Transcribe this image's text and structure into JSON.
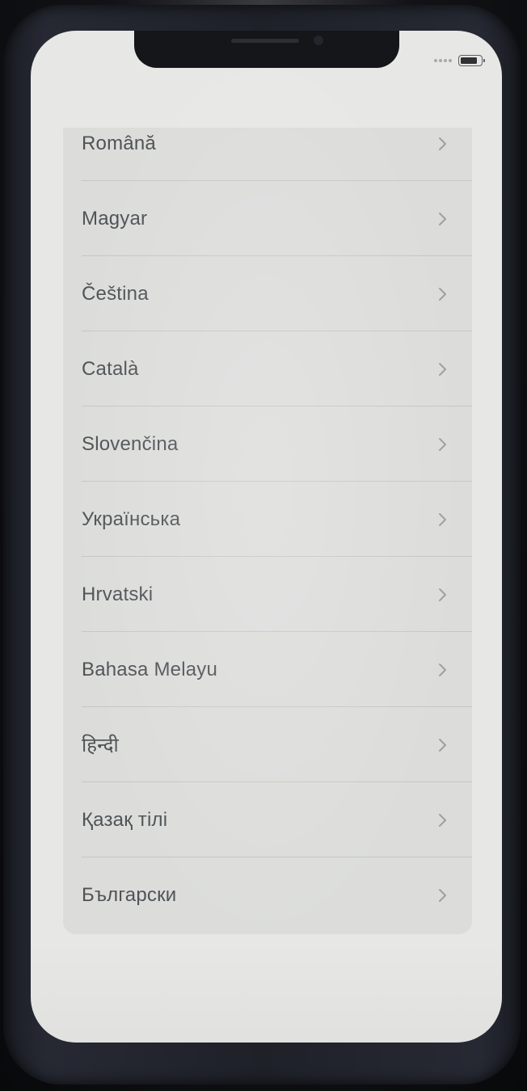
{
  "status_bar": {
    "battery_level": 0.7
  },
  "language_list": {
    "items": [
      {
        "label": "Română"
      },
      {
        "label": "Magyar"
      },
      {
        "label": "Čeština"
      },
      {
        "label": "Català"
      },
      {
        "label": "Slovenčina"
      },
      {
        "label": "Українська"
      },
      {
        "label": "Hrvatski"
      },
      {
        "label": "Bahasa Melayu"
      },
      {
        "label": "हिन्दी"
      },
      {
        "label": "Қазақ тілі"
      },
      {
        "label": "Български"
      }
    ],
    "chevron_icon": "chevron-right-icon"
  },
  "colors": {
    "screen_background": "#e7e8e6",
    "card_background": "#dcdddb",
    "label_text": "#4f5356",
    "separator": "#c6c7c5",
    "chevron": "#9d9fa0"
  }
}
